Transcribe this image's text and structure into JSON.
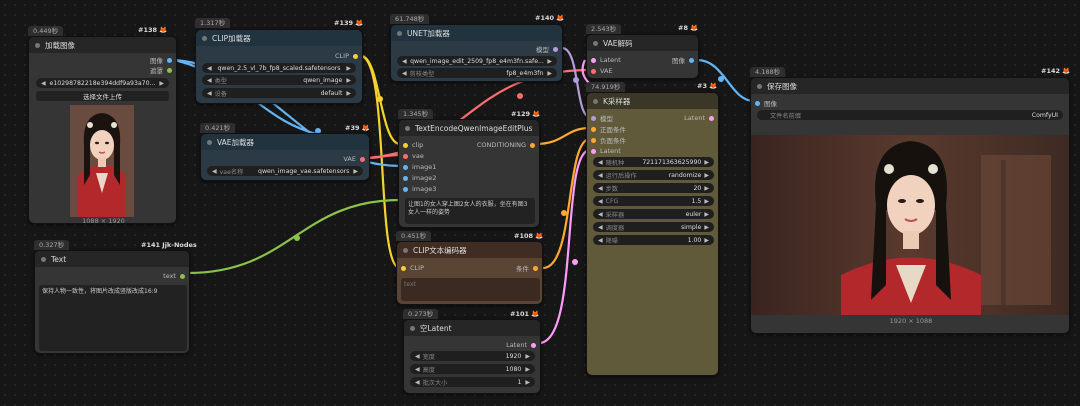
{
  "nodes": {
    "load_image": {
      "time": "0.449秒",
      "id": "#138",
      "title": "加载图像",
      "out_image": "图像",
      "out_mask": "遮罩",
      "file": "e10298782218e394ddf9a93a70...",
      "upload_btn": "选择文件上传",
      "dims": "1088 × 1920"
    },
    "clip_loader": {
      "time": "1.317秒",
      "id": "#139",
      "title": "CLIP加载器",
      "out_clip": "CLIP",
      "w1_value": "qwen_2.5_vl_7b_fp8_scaled.safetensors",
      "w2_label": "类型",
      "w2_value": "qwen_image",
      "w3_label": "设备",
      "w3_value": "default"
    },
    "unet_loader": {
      "time": "61.748秒",
      "id": "#140",
      "title": "UNET加载器",
      "out_model": "模型",
      "w1_value": "qwen_image_edit_2509_fp8_e4m3fn.safe...",
      "w2_label": "剪枝类型",
      "w2_value": "fp8_e4m3fn"
    },
    "vae_decode": {
      "time": "2.543秒",
      "id": "#8",
      "title": "VAE解码",
      "in_latent": "Latent",
      "in_vae": "VAE",
      "out_image": "图像"
    },
    "vae_loader": {
      "time": "0.421秒",
      "id": "#39",
      "title": "VAE加载器",
      "out_vae": "VAE",
      "w1_label": "vae名称",
      "w1_value": "qwen_image_vae.safetensors"
    },
    "text_encode": {
      "time": "1.345秒",
      "id": "#129",
      "title": "TextEncodeQwenImageEditPlus",
      "in_clip": "clip",
      "in_vae": "vae",
      "in_image1": "image1",
      "in_image2": "image2",
      "in_image3": "image3",
      "out_cond": "CONDITIONING",
      "prompt": "让图1的女人穿上图2女人的衣服，坐在有图3女人一样的姿势"
    },
    "ksampler": {
      "time": "74.919秒",
      "id": "#3",
      "title": "K采样器",
      "in_model": "模型",
      "in_pos": "正面条件",
      "in_neg": "负面条件",
      "in_latent": "Latent",
      "out_latent": "Latent",
      "widgets": [
        {
          "label": "随机种",
          "value": "721171363625990"
        },
        {
          "label": "运行后操作",
          "value": "randomize"
        },
        {
          "label": "步数",
          "value": "20"
        },
        {
          "label": "CFG",
          "value": "1.5"
        },
        {
          "label": "采样器",
          "value": "euler"
        },
        {
          "label": "调度器",
          "value": "simple"
        },
        {
          "label": "降噪",
          "value": "1.00"
        }
      ]
    },
    "save_image": {
      "time": "4.188秒",
      "id": "#142",
      "title": "保存图像",
      "in_image": "图像",
      "w1_label": "文件名前缀",
      "w1_value": "ComfyUI",
      "dims": "1920 × 1088"
    },
    "text_node": {
      "time": "0.327秒",
      "id": "#141 Jjk-Nodes",
      "title": "Text",
      "out_text": "text",
      "content": "保持人物一致性，将图片改成竖版改成16:9"
    },
    "clip_text": {
      "time": "0.451秒",
      "id": "#108",
      "title": "CLIP文本编码器",
      "in_clip": "CLIP",
      "out_cond": "条件",
      "placeholder": "text"
    },
    "empty_latent": {
      "time": "0.273秒",
      "id": "#101",
      "title": "空Latent",
      "out_latent": "Latent",
      "w1_label": "宽度",
      "w1_value": "1920",
      "w2_label": "高度",
      "w2_value": "1080",
      "w3_label": "批次大小",
      "w3_value": "1"
    }
  },
  "colors": {
    "clip_wire": "#f5d22e",
    "vae_wire": "#ff6e6e",
    "image_wire": "#64b5f6",
    "latent_wire": "#ff9cf9",
    "model_wire": "#b39ddb",
    "cond_wire": "#ffa931",
    "text_wire": "#8bc34a"
  }
}
